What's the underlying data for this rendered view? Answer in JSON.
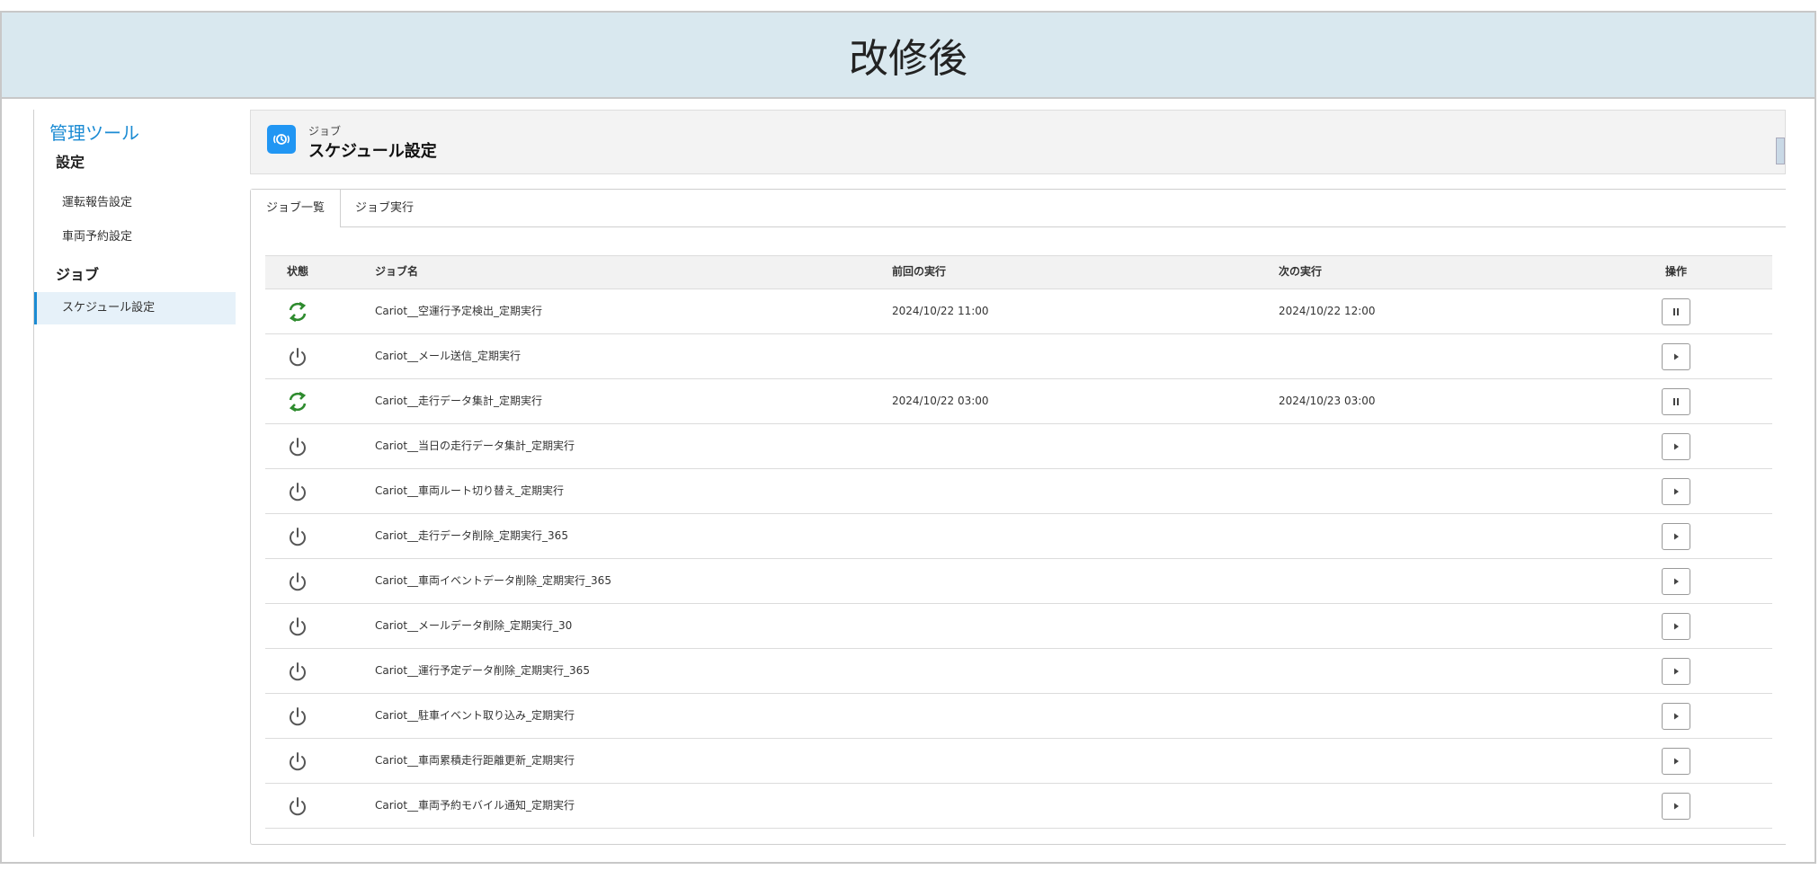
{
  "banner": {
    "title": "改修後"
  },
  "sidebar": {
    "title": "管理ツール",
    "sections": [
      {
        "label": "設定",
        "items": [
          {
            "label": "運転報告設定",
            "active": false
          },
          {
            "label": "車両予約設定",
            "active": false
          }
        ]
      },
      {
        "label": "ジョブ",
        "items": [
          {
            "label": "スケジュール設定",
            "active": true
          }
        ]
      }
    ]
  },
  "page_header": {
    "eyebrow": "ジョブ",
    "title": "スケジュール設定",
    "icon": "clock-sync-icon",
    "accent": "#2196f3"
  },
  "tabs": [
    {
      "label": "ジョブ一覧",
      "active": true
    },
    {
      "label": "ジョブ実行",
      "active": false
    }
  ],
  "table": {
    "headers": {
      "status": "状態",
      "name": "ジョブ名",
      "prev": "前回の実行",
      "next": "次の実行",
      "action": "操作"
    },
    "rows": [
      {
        "status": "running",
        "name": "Cariot__空運行予定検出_定期実行",
        "prev": "2024/10/22 11:00",
        "next": "2024/10/22 12:00",
        "action": "pause"
      },
      {
        "status": "stopped",
        "name": "Cariot__メール送信_定期実行",
        "prev": "",
        "next": "",
        "action": "play"
      },
      {
        "status": "running",
        "name": "Cariot__走行データ集計_定期実行",
        "prev": "2024/10/22 03:00",
        "next": "2024/10/23 03:00",
        "action": "pause"
      },
      {
        "status": "stopped",
        "name": "Cariot__当日の走行データ集計_定期実行",
        "prev": "",
        "next": "",
        "action": "play"
      },
      {
        "status": "stopped",
        "name": "Cariot__車両ルート切り替え_定期実行",
        "prev": "",
        "next": "",
        "action": "play"
      },
      {
        "status": "stopped",
        "name": "Cariot__走行データ削除_定期実行_365",
        "prev": "",
        "next": "",
        "action": "play"
      },
      {
        "status": "stopped",
        "name": "Cariot__車両イベントデータ削除_定期実行_365",
        "prev": "",
        "next": "",
        "action": "play"
      },
      {
        "status": "stopped",
        "name": "Cariot__メールデータ削除_定期実行_30",
        "prev": "",
        "next": "",
        "action": "play"
      },
      {
        "status": "stopped",
        "name": "Cariot__運行予定データ削除_定期実行_365",
        "prev": "",
        "next": "",
        "action": "play"
      },
      {
        "status": "stopped",
        "name": "Cariot__駐車イベント取り込み_定期実行",
        "prev": "",
        "next": "",
        "action": "play"
      },
      {
        "status": "stopped",
        "name": "Cariot__車両累積走行距離更新_定期実行",
        "prev": "",
        "next": "",
        "action": "play"
      },
      {
        "status": "stopped",
        "name": "Cariot__車両予約モバイル通知_定期実行",
        "prev": "",
        "next": "",
        "action": "play"
      }
    ]
  },
  "colors": {
    "running": "#2e8b2e",
    "stopped": "#555555",
    "link": "#1b8bd3",
    "banner_bg": "#d9e8ef"
  }
}
